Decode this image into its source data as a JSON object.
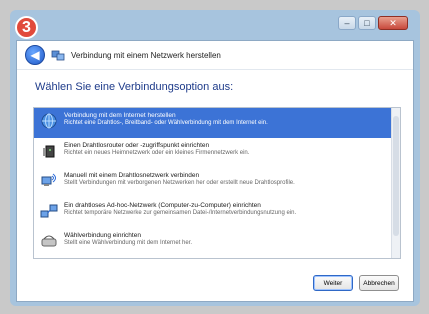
{
  "badge": {
    "number": "3"
  },
  "window": {
    "title": "Verbindung mit einem Netzwerk herstellen"
  },
  "heading": "Wählen Sie eine Verbindungsoption aus:",
  "options": [
    {
      "title": "Verbindung mit dem Internet herstellen",
      "desc": "Richtet eine Drahtlos-, Breitband- oder Wählverbindung mit dem Internet ein.",
      "icon": "globe-icon",
      "selected": true
    },
    {
      "title": "Einen Drahtlosrouter oder -zugriffspunkt einrichten",
      "desc": "Richtet ein neues Heimnetzwerk oder ein kleines Firmennetzwerk ein.",
      "icon": "router-icon",
      "selected": false
    },
    {
      "title": "Manuell mit einem Drahtlosnetzwerk verbinden",
      "desc": "Stellt Verbindungen mit verborgenen Netzwerken her oder erstellt neue Drahtlosprofile.",
      "icon": "wireless-network-icon",
      "selected": false
    },
    {
      "title": "Ein drahtloses Ad-hoc-Netzwerk (Computer-zu-Computer) einrichten",
      "desc": "Richtet temporäre Netzwerke zur gemeinsamen Datei-/Internetverbindungsnutzung ein.",
      "icon": "adhoc-network-icon",
      "selected": false
    },
    {
      "title": "Wählverbindung einrichten",
      "desc": "Stellt eine Wählverbindung mit dem Internet her.",
      "icon": "modem-icon",
      "selected": false
    }
  ],
  "buttons": {
    "next": "Weiter",
    "cancel": "Abbrechen"
  },
  "colors": {
    "selection": "#3c73d6",
    "heading": "#1e3b8a",
    "badge": "#e14a3b"
  }
}
